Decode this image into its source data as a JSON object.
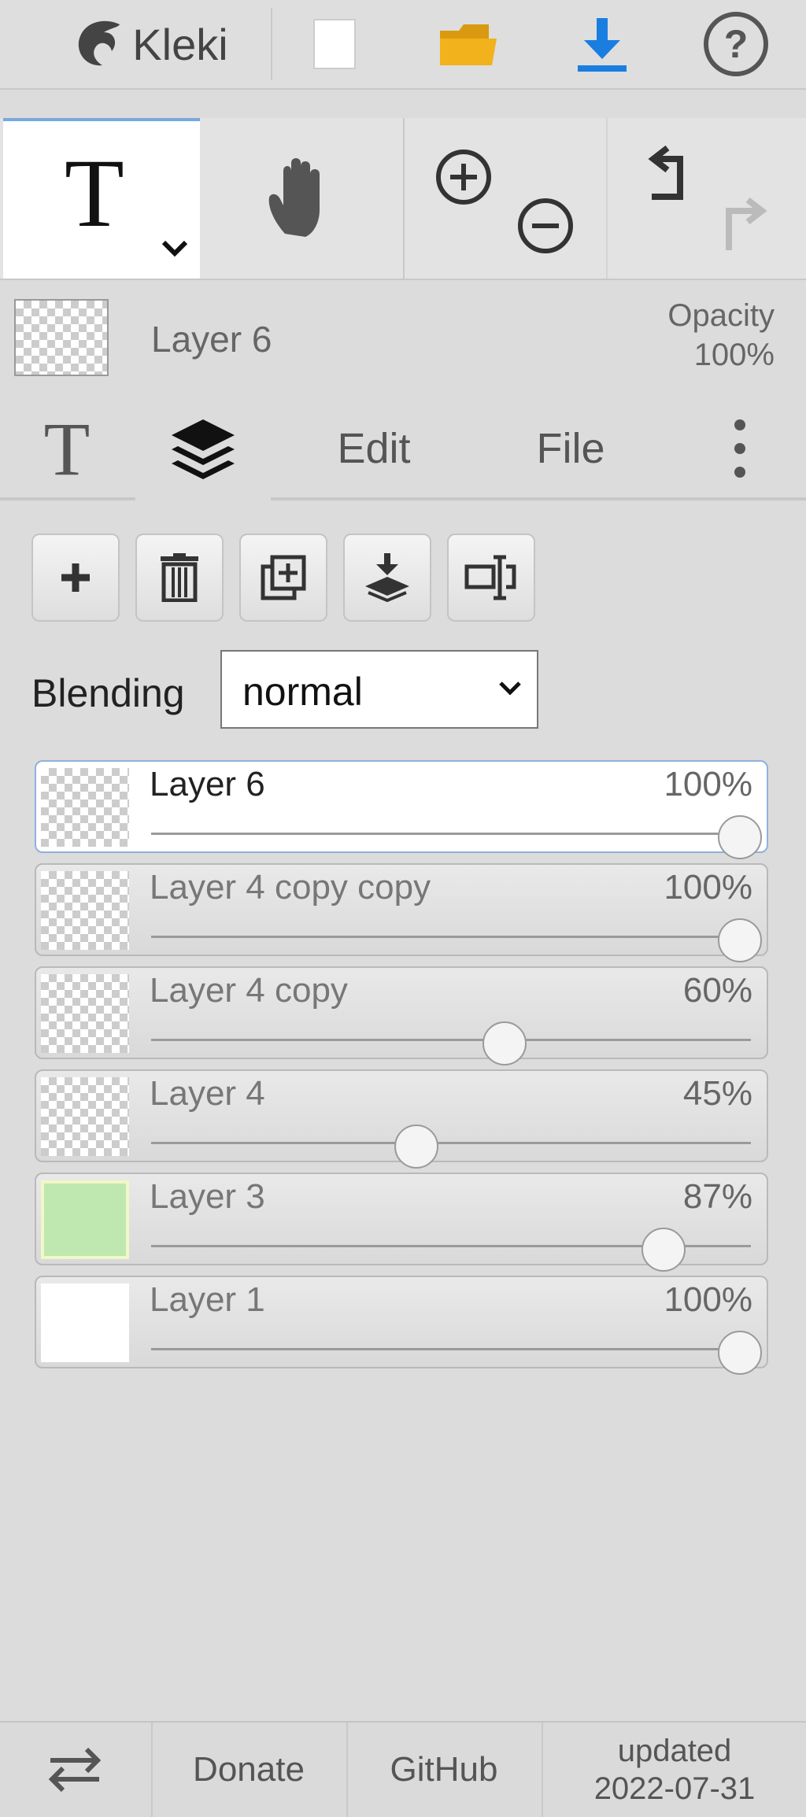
{
  "app": {
    "logo_text": "Kleki"
  },
  "layer_info": {
    "name": "Layer 6",
    "opacity_label": "Opacity",
    "opacity_value": "100%"
  },
  "tabs": [
    {
      "id": "brush",
      "label": "T"
    },
    {
      "id": "layers",
      "icon": "layers-icon"
    },
    {
      "id": "edit",
      "label": "Edit"
    },
    {
      "id": "file",
      "label": "File"
    }
  ],
  "blending": {
    "label": "Blending",
    "value": "normal"
  },
  "layers": [
    {
      "name": "Layer 6",
      "opacity": "100%",
      "opacity_fraction": 1.0,
      "active": true
    },
    {
      "name": "Layer 4 copy copy",
      "opacity": "100%",
      "opacity_fraction": 1.0
    },
    {
      "name": "Layer 4 copy",
      "opacity": "60%",
      "opacity_fraction": 0.6
    },
    {
      "name": "Layer 4",
      "opacity": "45%",
      "opacity_fraction": 0.45
    },
    {
      "name": "Layer 3",
      "opacity": "87%",
      "opacity_fraction": 0.87
    },
    {
      "name": "Layer 1",
      "opacity": "100%",
      "opacity_fraction": 1.0
    }
  ],
  "footer": {
    "donate": "Donate",
    "github": "GitHub",
    "updated_label": "updated",
    "updated_date": "2022-07-31"
  },
  "colors": {
    "accent": "#1a7ee0",
    "folder": "#f2b21c",
    "active_border": "#8fb1de"
  }
}
